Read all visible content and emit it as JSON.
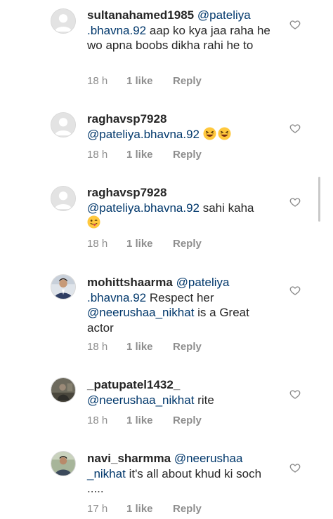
{
  "comments": [
    {
      "username": "sultanahamed1985",
      "mention": "@pateliya .bhavna.92",
      "text": "aap ko kya jaa raha he wo apna boobs dikha rahi he to",
      "time": "18 h",
      "likes": "1 like",
      "reply": "Reply",
      "avatar": "default-avatar-icon"
    },
    {
      "username": "raghavsp7928",
      "mention": "@pateliya.bhavna.92",
      "text": "",
      "emojis": [
        "grinning-squinting-face-emoji",
        "grinning-squinting-face-emoji"
      ],
      "time": "18 h",
      "likes": "1 like",
      "reply": "Reply",
      "avatar": "default-avatar-icon"
    },
    {
      "username": "raghavsp7928",
      "mention": "@pateliya.bhavna.92",
      "text": "sahi kaha",
      "emojis": [
        "winking-tongue-face-emoji"
      ],
      "time": "18 h",
      "likes": "1 like",
      "reply": "Reply",
      "avatar": "default-avatar-icon"
    },
    {
      "username": "mohittshaarma",
      "mention": "@pateliya .bhavna.92",
      "text": "Respect her",
      "mention2": "@neerushaa_nikhat",
      "text2": "is a Great actor",
      "time": "18 h",
      "likes": "1 like",
      "reply": "Reply",
      "avatar": "user-photo-avatar"
    },
    {
      "username": "_patupatel1432_",
      "mention": "@neerushaa_nikhat",
      "text": "rite",
      "time": "18 h",
      "likes": "1 like",
      "reply": "Reply",
      "avatar": "user-photo-avatar"
    },
    {
      "username": "navi_sharmma",
      "mention": "@neerushaa _nikhat",
      "text": "it's all about khud ki soch .....",
      "time": "17 h",
      "likes": "1 like",
      "reply": "Reply",
      "avatar": "user-photo-avatar"
    }
  ],
  "icons": {
    "like": "heart-outline-icon"
  },
  "colors": {
    "text": "#262626",
    "mention": "#00376b",
    "meta": "#8e8e8e"
  }
}
